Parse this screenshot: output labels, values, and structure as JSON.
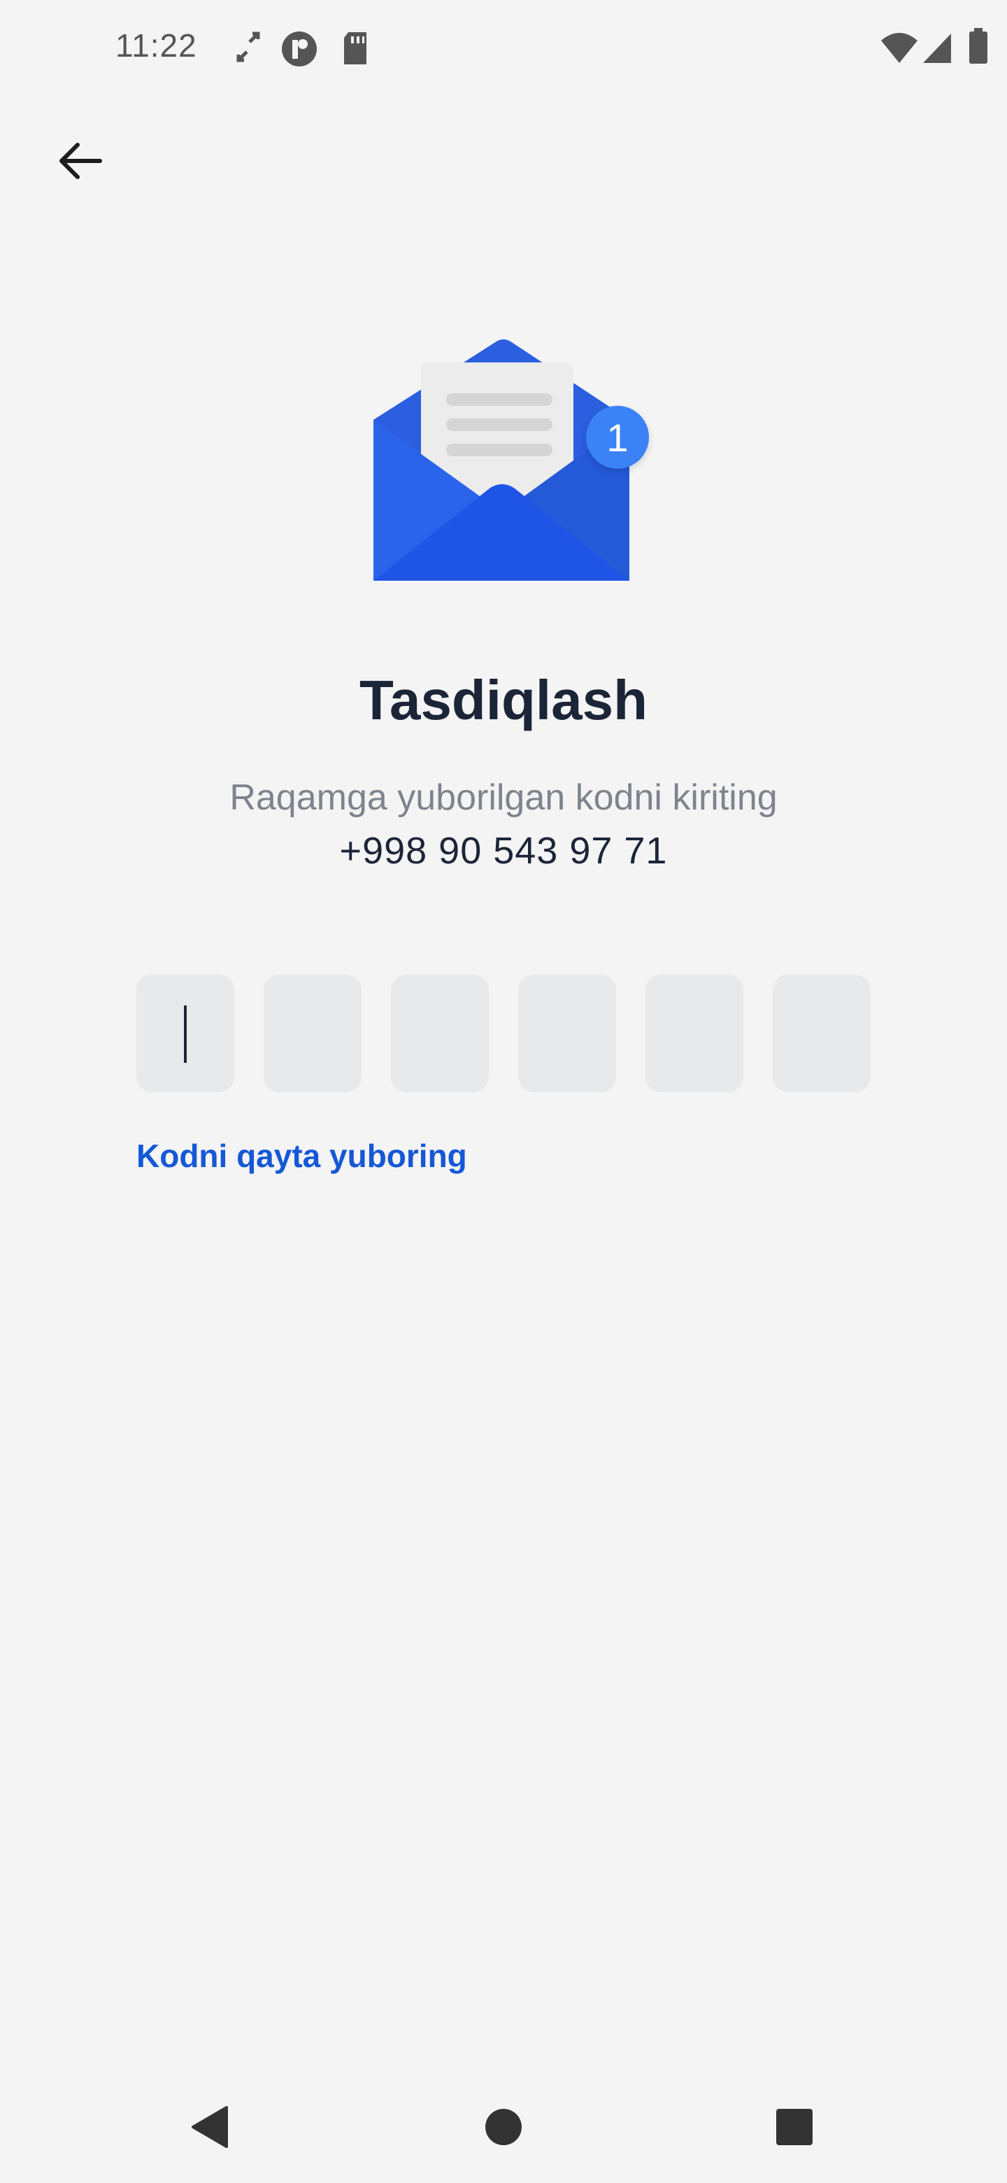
{
  "status_bar": {
    "time": "11:22",
    "icons": [
      "sync-icon",
      "app-r-icon",
      "sd-card-icon",
      "wifi-icon",
      "signal-icon",
      "battery-icon"
    ]
  },
  "header": {
    "back_icon": "arrow-left-icon"
  },
  "hero": {
    "badge_count": "1",
    "colors": {
      "envelope": "#2563eb",
      "badge": "#3b82f6"
    }
  },
  "main": {
    "title": "Tasdiqlash",
    "subtitle": "Raqamga yuborilgan kodni kiriting",
    "phone": "+998 90 543 97 71",
    "otp": {
      "length": 6,
      "values": [
        "",
        "",
        "",
        "",
        "",
        ""
      ]
    },
    "resend_label": "Kodni qayta yuboring"
  },
  "nav_bar": {
    "icons": [
      "back-triangle-icon",
      "home-circle-icon",
      "recents-square-icon"
    ]
  },
  "colors": {
    "accent": "#1558d6",
    "title": "#1c2538",
    "muted": "#7e848e",
    "background": "#f4f4f4"
  }
}
